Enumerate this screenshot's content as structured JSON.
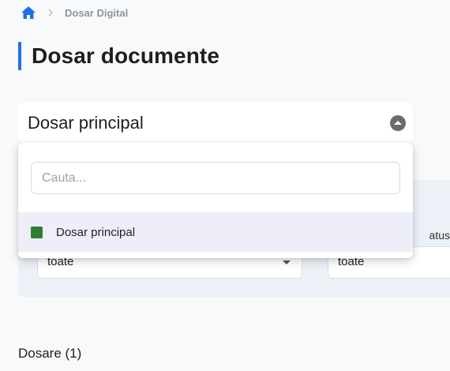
{
  "breadcrumb": {
    "home_icon": "home-icon",
    "separator_icon": "chevron-right-icon",
    "current": "Dosar Digital"
  },
  "page": {
    "title": "Dosar documente",
    "accent_color": "#1f6fe6"
  },
  "dosar_select": {
    "selected_label": "Dosar principal",
    "toggle_icon": "chevron-up-circle-icon",
    "expanded": true
  },
  "dropdown": {
    "search_placeholder": "Cauta...",
    "search_value": "",
    "options": [
      {
        "label": "Dosar principal",
        "color": "#2f7d32",
        "highlighted": true
      }
    ]
  },
  "filters": {
    "status_label_partial": "atus",
    "select_1_value": "toate",
    "select_2_value": "toate"
  },
  "section": {
    "count_label": "Dosare (1)"
  }
}
